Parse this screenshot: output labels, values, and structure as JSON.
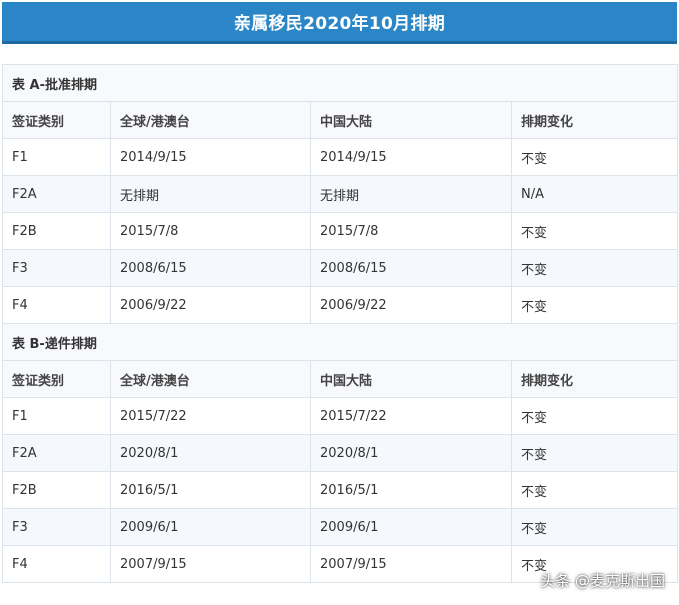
{
  "banner": {
    "title": "亲属移民2020年10月排期"
  },
  "columns": [
    "签证类别",
    "全球/港澳台",
    "中国大陆",
    "排期变化"
  ],
  "table_a": {
    "title": "表 A-批准排期",
    "rows": [
      [
        "F1",
        "2014/9/15",
        "2014/9/15",
        "不变"
      ],
      [
        "F2A",
        "无排期",
        "无排期",
        "N/A"
      ],
      [
        "F2B",
        "2015/7/8",
        "2015/7/8",
        "不变"
      ],
      [
        "F3",
        "2008/6/15",
        "2008/6/15",
        "不变"
      ],
      [
        "F4",
        "2006/9/22",
        "2006/9/22",
        "不变"
      ]
    ]
  },
  "table_b": {
    "title": "表 B-递件排期",
    "rows": [
      [
        "F1",
        "2015/7/22",
        "2015/7/22",
        "不变"
      ],
      [
        "F2A",
        "2020/8/1",
        "2020/8/1",
        "不变"
      ],
      [
        "F2B",
        "2016/5/1",
        "2016/5/1",
        "不变"
      ],
      [
        "F3",
        "2009/6/1",
        "2009/6/1",
        "不变"
      ],
      [
        "F4",
        "2007/9/15",
        "2007/9/15",
        "不变"
      ]
    ]
  },
  "watermark": "头条 @麦克斯出国"
}
